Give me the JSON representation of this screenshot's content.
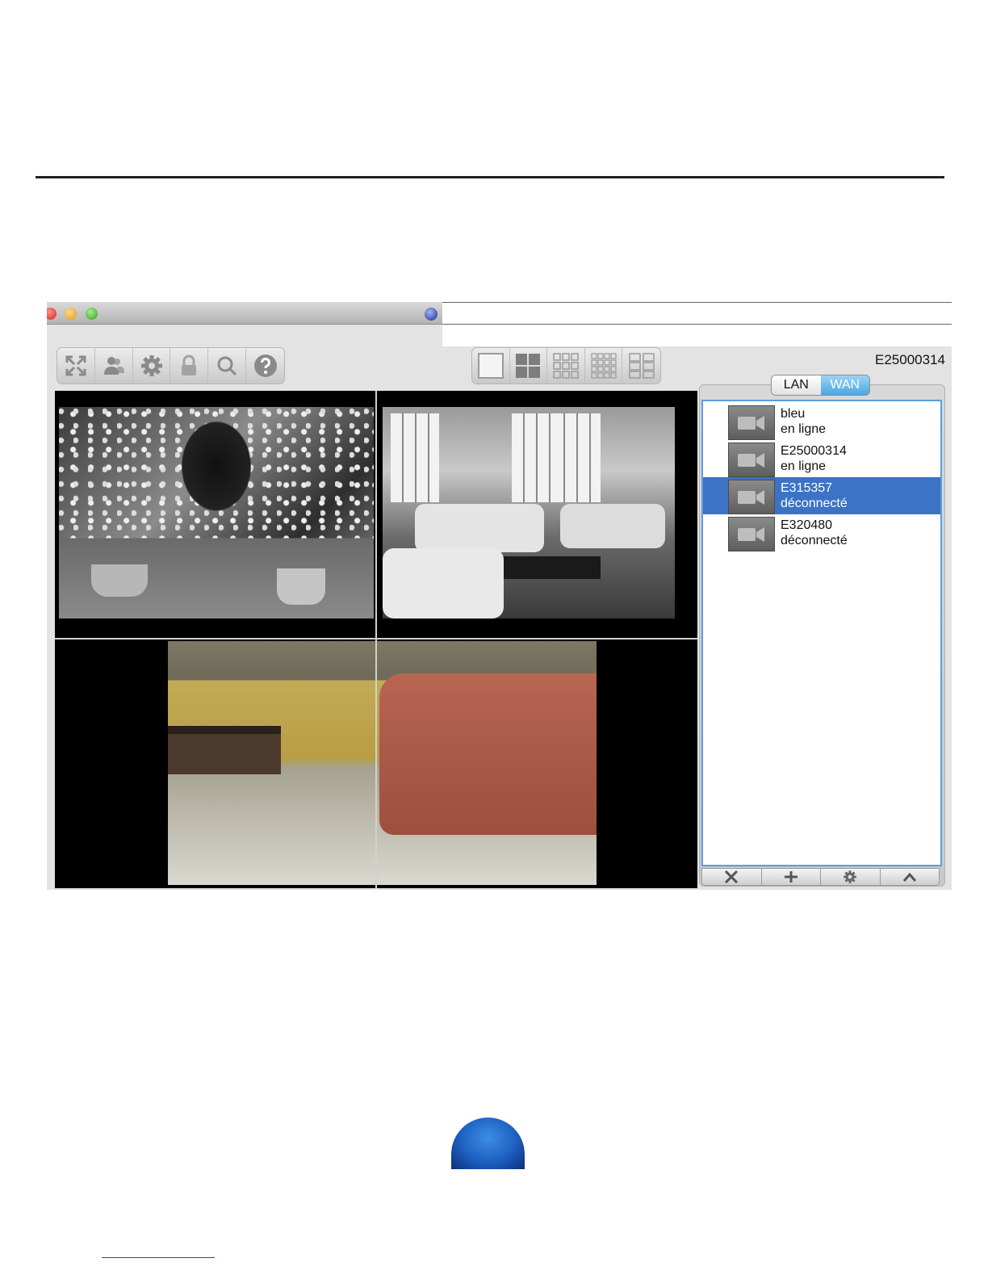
{
  "window": {
    "device_id": "E25000314",
    "network_tabs": {
      "lan": "LAN",
      "wan": "WAN",
      "selected": "WAN"
    }
  },
  "toolbar": {
    "icons": [
      "fullscreen-icon",
      "users-icon",
      "settings-gear-icon",
      "lock-icon",
      "search-icon",
      "help-icon"
    ],
    "layout_icons": [
      "layout-1-icon",
      "layout-4-icon",
      "layout-9-icon",
      "layout-16-icon",
      "layout-6-icon"
    ]
  },
  "devices": [
    {
      "name": "bleu",
      "status": "en ligne",
      "selected": false
    },
    {
      "name": "E25000314",
      "status": "en ligne",
      "selected": false
    },
    {
      "name": "E315357",
      "status": "déconnecté",
      "selected": true
    },
    {
      "name": "E320480",
      "status": "déconnecté",
      "selected": false
    }
  ],
  "list_actions": [
    "delete-icon",
    "add-icon",
    "settings-gear-icon",
    "collapse-icon"
  ],
  "colors": {
    "selection": "#3c73c5",
    "wan_tab": "#4aa6e4",
    "orb": "#1d5fc0"
  }
}
